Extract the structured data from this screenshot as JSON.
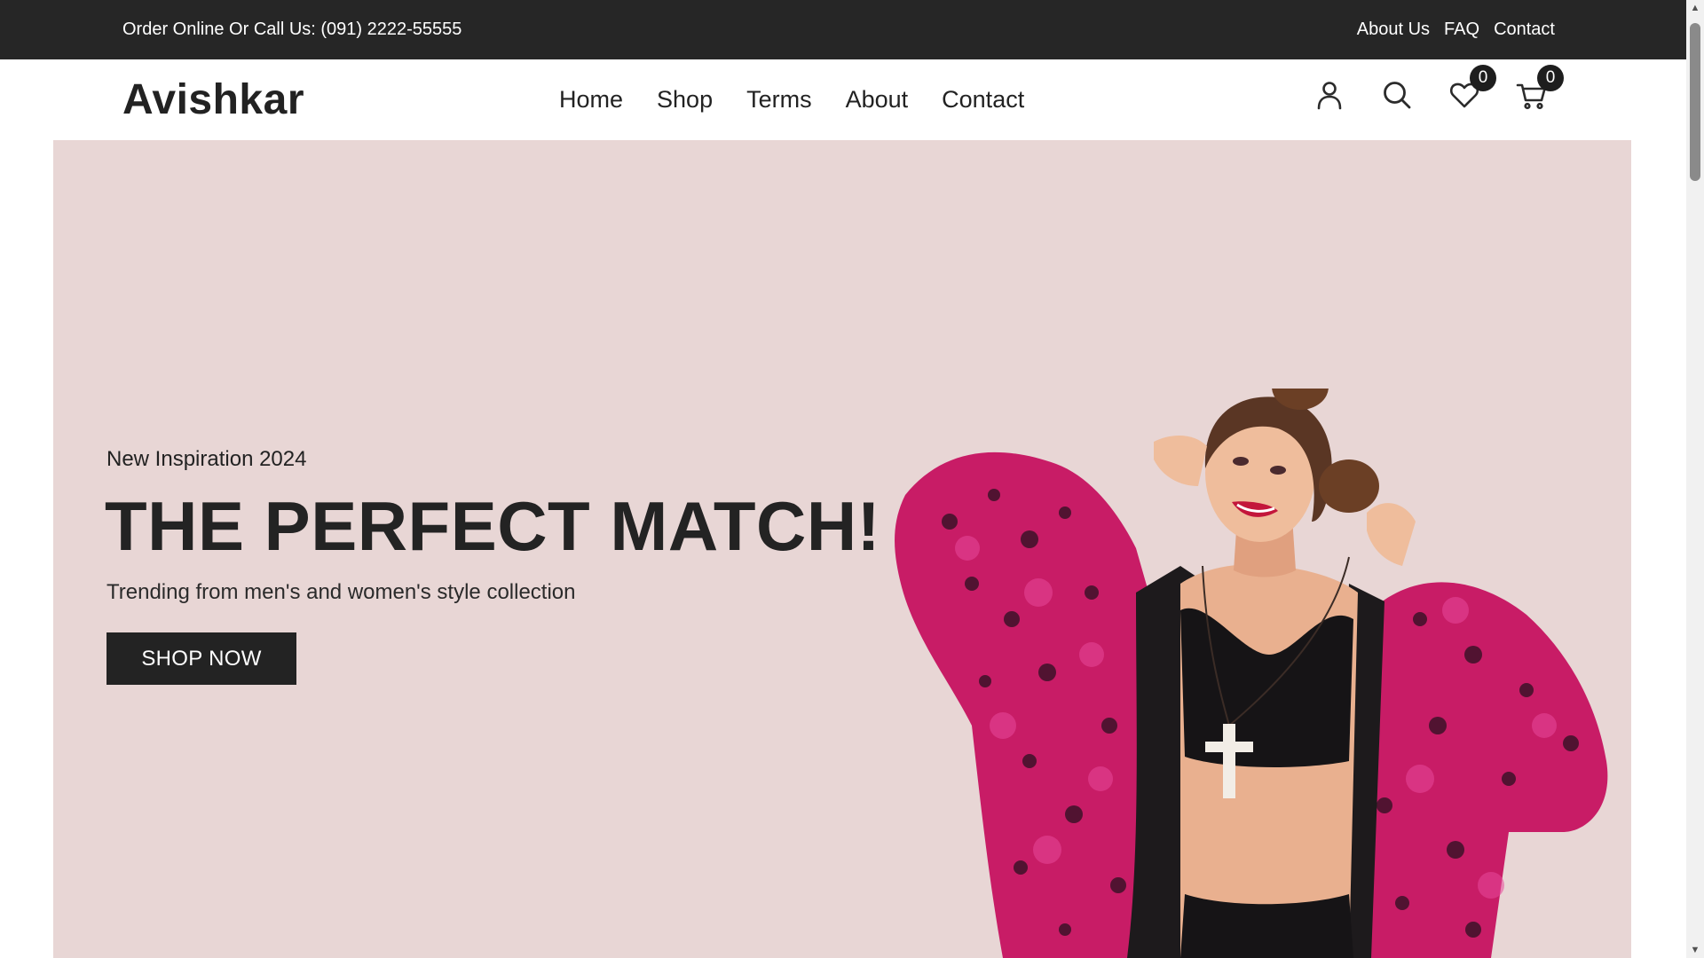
{
  "topbar": {
    "phone_text": "Order Online Or Call Us: (091) 2222-55555",
    "links": [
      "About Us",
      "FAQ",
      "Contact"
    ]
  },
  "header": {
    "logo": "Avishkar",
    "nav": [
      "Home",
      "Shop",
      "Terms",
      "About",
      "Contact"
    ],
    "icons": [
      "user-icon",
      "search-icon",
      "heart-icon",
      "cart-icon"
    ],
    "wishlist_count": "0",
    "cart_count": "0"
  },
  "hero": {
    "eyebrow": "New Inspiration 2024",
    "title": "THE PERFECT MATCH!",
    "subtitle": "Trending from men's and women's style collection",
    "button_label": "SHOP NOW",
    "background_color": "#e8d6d5",
    "image": "woman-in-pink-fur-coat-photo"
  },
  "colors": {
    "topbar": "#262626",
    "text": "#222222",
    "button": "#232323",
    "accent_pink": "#d6226f"
  }
}
